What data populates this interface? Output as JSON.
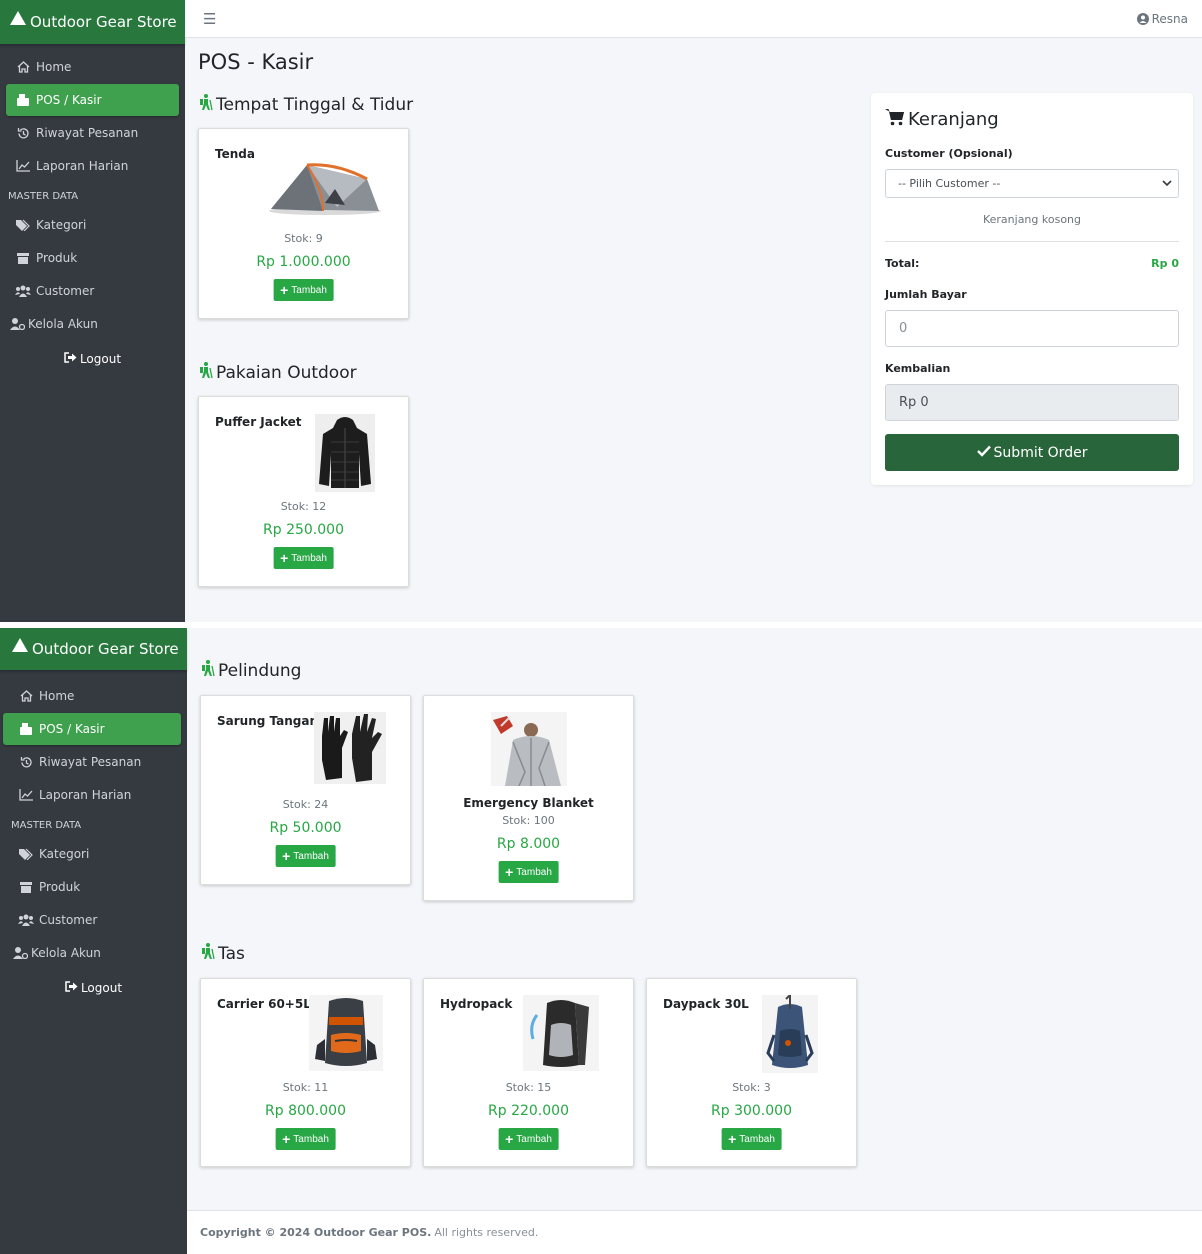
{
  "brand": {
    "name": "Outdoor Gear Store"
  },
  "user": {
    "name": "Resna"
  },
  "sidebar": {
    "items": [
      {
        "label": "Home",
        "icon": "home-icon"
      },
      {
        "label": "POS / Kasir",
        "icon": "cash-register-icon",
        "active": true
      },
      {
        "label": "Riwayat Pesanan",
        "icon": "history-icon"
      },
      {
        "label": "Laporan Harian",
        "icon": "chart-line-icon"
      }
    ],
    "header": "MASTER DATA",
    "master_items": [
      {
        "label": "Kategori",
        "icon": "tags-icon"
      },
      {
        "label": "Produk",
        "icon": "box-icon"
      },
      {
        "label": "Customer",
        "icon": "users-icon"
      },
      {
        "label": "Kelola Akun",
        "icon": "user-cog-icon"
      }
    ],
    "logout": "Logout"
  },
  "page": {
    "title": "POS - Kasir"
  },
  "categories": [
    {
      "name": "Tempat Tinggal & Tidur",
      "products": [
        {
          "name": "Tenda",
          "stock": "Stok: 9",
          "price": "Rp 1.000.000",
          "button": "Tambah"
        }
      ]
    },
    {
      "name": "Pakaian Outdoor",
      "products": [
        {
          "name": "Puffer Jacket",
          "stock": "Stok: 12",
          "price": "Rp 250.000",
          "button": "Tambah"
        }
      ]
    },
    {
      "name": "Pelindung",
      "products": [
        {
          "name": "Sarung Tangan",
          "stock": "Stok: 24",
          "price": "Rp 50.000",
          "button": "Tambah"
        },
        {
          "name": "Emergency Blanket",
          "stock": "Stok: 100",
          "price": "Rp 8.000",
          "button": "Tambah"
        }
      ]
    },
    {
      "name": "Tas",
      "products": [
        {
          "name": "Carrier 60+5L",
          "stock": "Stok: 11",
          "price": "Rp 800.000",
          "button": "Tambah"
        },
        {
          "name": "Hydropack",
          "stock": "Stok: 15",
          "price": "Rp 220.000",
          "button": "Tambah"
        },
        {
          "name": "Daypack 30L",
          "stock": "Stok: 3",
          "price": "Rp 300.000",
          "button": "Tambah"
        }
      ]
    }
  ],
  "cart": {
    "title": "Keranjang",
    "customer_label": "Customer (Opsional)",
    "customer_placeholder": "-- Pilih Customer --",
    "empty_text": "Keranjang kosong",
    "total_label": "Total:",
    "total_value": "Rp 0",
    "pay_label": "Jumlah Bayar",
    "pay_value": "0",
    "change_label": "Kembalian",
    "change_value": "Rp 0",
    "submit_label": "Submit Order"
  },
  "footer": {
    "copyright": "Copyright © 2024 Outdoor Gear POS.",
    "rights": "All rights reserved."
  },
  "colors": {
    "sidebar": "#343a40",
    "brand": "#28783e",
    "active": "#3fa04e",
    "price": "#28a745",
    "submit": "#28653a"
  }
}
